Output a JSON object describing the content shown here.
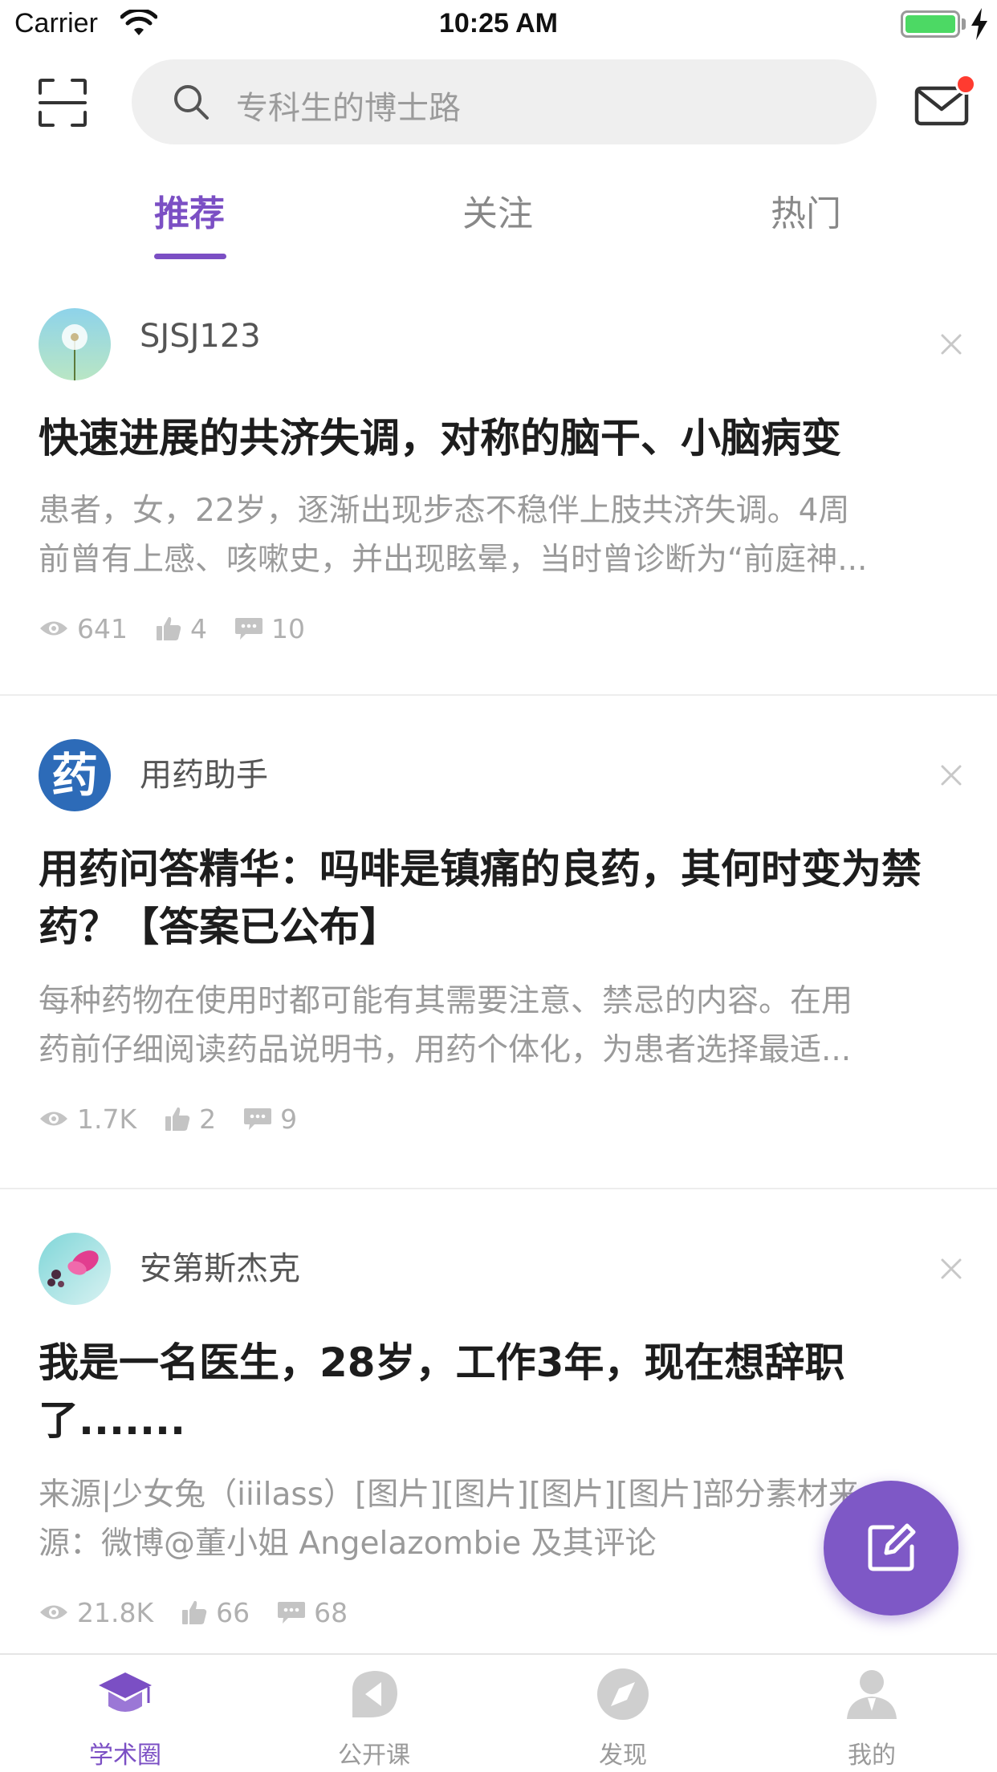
{
  "status_bar": {
    "carrier": "Carrier",
    "time": "10:25 AM"
  },
  "header": {
    "search_placeholder": "专科生的博士路",
    "has_unread_mail": true
  },
  "tabs": [
    {
      "label": "推荐",
      "active": true
    },
    {
      "label": "关注",
      "active": false
    },
    {
      "label": "热门",
      "active": false
    }
  ],
  "posts": [
    {
      "author": "SJSJ123",
      "avatar": "dandelion-photo",
      "title": "快速进展的共济失调，对称的脑干、小脑病变",
      "excerpt_line1": "患者，女，22岁，逐渐出现步态不稳伴上肢共济失调。4周",
      "excerpt_line2": "前曾有上感、咳嗽史，并出现眩晕，当时曾诊断为“前庭神...",
      "views": "641",
      "likes": "4",
      "comments": "10"
    },
    {
      "author": "用药助手",
      "avatar": "药",
      "title": "用药问答精华：吗啡是镇痛的良药，其何时变为禁药？【答案已公布】",
      "excerpt_line1": "每种药物在使用时都可能有其需要注意、禁忌的内容。在用",
      "excerpt_line2": "药前仔细阅读药品说明书，用药个体化，为患者选择最适...",
      "views": "1.7K",
      "likes": "2",
      "comments": "9"
    },
    {
      "author": "安第斯杰克",
      "avatar": "pink-flower-photo",
      "title": "我是一名医生，28岁，工作3年，现在想辞职了.......",
      "excerpt_line1": "来源|少女兔（iiilass）[图片][图片][图片][图片]部分素材来",
      "excerpt_line2": "源：微博@董小姐 Angelazombie 及其评论",
      "views": "21.8K",
      "likes": "66",
      "comments": "68"
    }
  ],
  "tabbar": [
    {
      "label": "学术圈",
      "icon": "graduation-cap-icon",
      "active": true
    },
    {
      "label": "公开课",
      "icon": "play-leaf-icon",
      "active": false
    },
    {
      "label": "发现",
      "icon": "compass-icon",
      "active": false
    },
    {
      "label": "我的",
      "icon": "person-icon",
      "active": false
    }
  ],
  "colors": {
    "accent": "#7b4fc4",
    "fab": "#7e58c6",
    "badge": "#ff3b30",
    "battery": "#4cd964"
  }
}
